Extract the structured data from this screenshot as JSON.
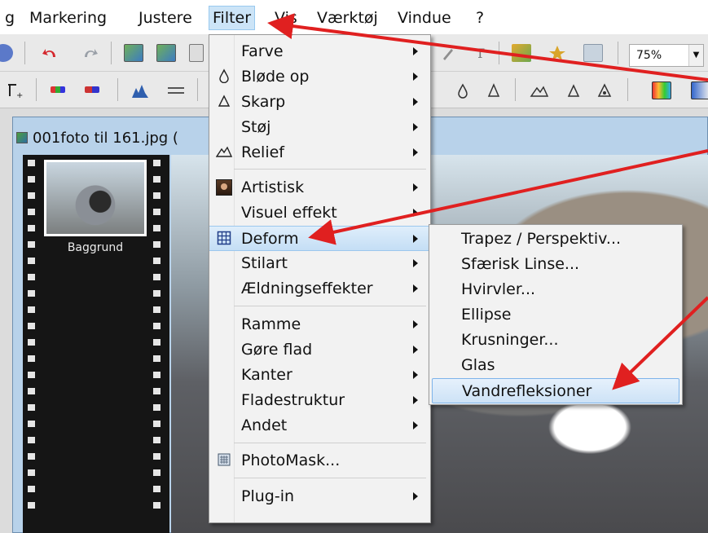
{
  "menubar": {
    "items": [
      {
        "label": "g"
      },
      {
        "label": "Markering"
      },
      {
        "label": "Justere"
      },
      {
        "label": "Filter"
      },
      {
        "label": "Vis"
      },
      {
        "label": "Værktøj"
      },
      {
        "label": "Vindue"
      },
      {
        "label": "?"
      }
    ]
  },
  "toolbar": {
    "zoom_value": "75%"
  },
  "document": {
    "title": "001foto til 161.jpg (",
    "layer_label": "Baggrund"
  },
  "filter_menu": {
    "items": [
      {
        "label": "Farve",
        "icon": "none",
        "has_submenu": true
      },
      {
        "label": "Bløde op",
        "icon": "drop-icon",
        "has_submenu": true
      },
      {
        "label": "Skarp",
        "icon": "triangle-icon",
        "has_submenu": true
      },
      {
        "label": "Støj",
        "icon": "none",
        "has_submenu": true
      },
      {
        "label": "Relief",
        "icon": "relief-icon",
        "has_submenu": true
      },
      {
        "label": "Artistisk",
        "icon": "portrait-icon",
        "has_submenu": true
      },
      {
        "label": "Visuel effekt",
        "icon": "none",
        "has_submenu": true
      },
      {
        "label": "Deform",
        "icon": "grid-icon",
        "has_submenu": true,
        "highlighted": true
      },
      {
        "label": "Stilart",
        "icon": "none",
        "has_submenu": true
      },
      {
        "label": "Ældningseffekter",
        "icon": "none",
        "has_submenu": true
      },
      {
        "label": "Ramme",
        "icon": "none",
        "has_submenu": true
      },
      {
        "label": "Gøre flad",
        "icon": "none",
        "has_submenu": true
      },
      {
        "label": "Kanter",
        "icon": "none",
        "has_submenu": true
      },
      {
        "label": "Fladestruktur",
        "icon": "none",
        "has_submenu": true
      },
      {
        "label": "Andet",
        "icon": "none",
        "has_submenu": true
      },
      {
        "label": "PhotoMask...",
        "icon": "photomask-icon",
        "has_submenu": false
      },
      {
        "label": "Plug-in",
        "icon": "none",
        "has_submenu": true
      }
    ]
  },
  "deform_submenu": {
    "items": [
      {
        "label": "Trapez / Perspektiv..."
      },
      {
        "label": "Sfærisk Linse..."
      },
      {
        "label": "Hvirvler..."
      },
      {
        "label": "Ellipse"
      },
      {
        "label": "Krusninger..."
      },
      {
        "label": "Glas"
      },
      {
        "label": "Vandrefleksioner",
        "highlighted": true
      }
    ]
  },
  "colors": {
    "highlight": "#c4def5",
    "arrow": "#e02020",
    "menu_bg": "#f2f2f2"
  }
}
